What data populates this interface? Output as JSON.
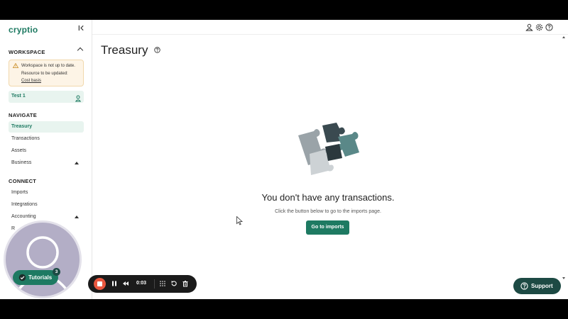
{
  "app": {
    "logo": "cryptio"
  },
  "sidebar": {
    "workspace_title": "WORKSPACE",
    "warning": {
      "line1": "Workspace is not up to date.",
      "line2": "Resource to be updated:",
      "link": "Cost basis"
    },
    "workspace_name": "Test 1",
    "navigate_title": "NAVIGATE",
    "navigate_items": [
      {
        "label": "Treasury",
        "active": true
      },
      {
        "label": "Transactions"
      },
      {
        "label": "Assets"
      },
      {
        "label": "Business",
        "expandable": true
      }
    ],
    "connect_title": "CONNECT",
    "connect_items": [
      {
        "label": "Imports"
      },
      {
        "label": "Integrations"
      },
      {
        "label": "Accounting",
        "expandable": true
      },
      {
        "label": "R"
      }
    ]
  },
  "header": {
    "title": "Treasury"
  },
  "empty_state": {
    "title": "You don't have any transactions.",
    "subtitle": "Click the button below to go to the imports page.",
    "button": "Go to imports"
  },
  "support": {
    "label": "Support"
  },
  "tutorials": {
    "label": "Tutorials",
    "badge": "3"
  },
  "recorder": {
    "time": "0:03"
  },
  "colors": {
    "brand": "#1e7a62",
    "support_bg": "#1d4a44",
    "warning_bg": "#fdf4e6",
    "record": "#e9573f"
  }
}
